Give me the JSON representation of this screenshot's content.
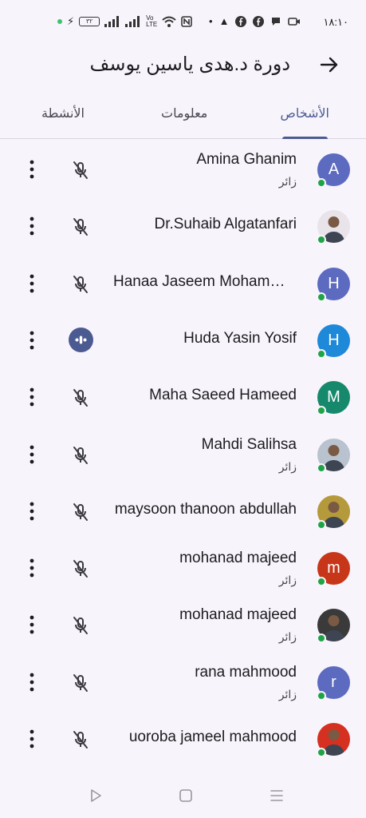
{
  "status_bar": {
    "time": "١٨:١٠",
    "battery": "٣٢"
  },
  "header": {
    "title": "دورة د.هدى ياسين يوسف"
  },
  "tabs": [
    {
      "label": "الأشخاص",
      "active": true
    },
    {
      "label": "معلومات",
      "active": false
    },
    {
      "label": "الأنشطة",
      "active": false
    }
  ],
  "participants": [
    {
      "name": "Amina Ghanim",
      "role": "زائر",
      "avatar_letter": "A",
      "avatar_color": "#5c6bc0",
      "photo": false,
      "speaking": false
    },
    {
      "name": "Dr.Suhaib Algatanfari",
      "role": "",
      "avatar_letter": "",
      "avatar_color": "#e9e4ea",
      "photo": true,
      "speaking": false
    },
    {
      "name": "Hanaa Jaseem Mohammed",
      "role": "",
      "avatar_letter": "H",
      "avatar_color": "#5c6bc0",
      "photo": false,
      "speaking": false
    },
    {
      "name": "Huda Yasin Yosif",
      "role": "",
      "avatar_letter": "H",
      "avatar_color": "#1e88d9",
      "photo": false,
      "speaking": true
    },
    {
      "name": "Maha Saeed Hameed",
      "role": "",
      "avatar_letter": "M",
      "avatar_color": "#16896c",
      "photo": false,
      "speaking": false
    },
    {
      "name": "Mahdi Salihsa",
      "role": "زائر",
      "avatar_letter": "",
      "avatar_color": "#b8c3cf",
      "photo": true,
      "speaking": false
    },
    {
      "name": "maysoon thanoon abdullah",
      "role": "",
      "avatar_letter": "",
      "avatar_color": "#b59a3c",
      "photo": true,
      "speaking": false
    },
    {
      "name": "mohanad majeed",
      "role": "زائر",
      "avatar_letter": "m",
      "avatar_color": "#c8361a",
      "photo": false,
      "speaking": false
    },
    {
      "name": "mohanad majeed",
      "role": "زائر",
      "avatar_letter": "",
      "avatar_color": "#3a3a3a",
      "photo": true,
      "speaking": false
    },
    {
      "name": "rana mahmood",
      "role": "زائر",
      "avatar_letter": "r",
      "avatar_color": "#5c6bc0",
      "photo": false,
      "speaking": false
    },
    {
      "name": "uoroba jameel mahmood",
      "role": "",
      "avatar_letter": "",
      "avatar_color": "#d63020",
      "photo": true,
      "speaking": false
    }
  ],
  "icons": {
    "back": "arrow-right-icon",
    "muted": "mic-off-icon",
    "speaking": "audio-levels-icon",
    "more": "more-vert-icon"
  },
  "colors": {
    "accent": "#4b5b92",
    "online": "#1ea446"
  }
}
